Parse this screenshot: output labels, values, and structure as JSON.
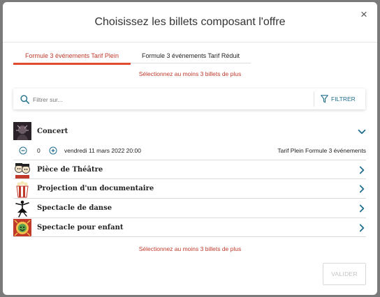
{
  "modal": {
    "title": "Choisissez les billets composant l'offre",
    "close_icon": "×"
  },
  "tabs": [
    {
      "label": "Formule 3 événements Tarif Plein",
      "active": true
    },
    {
      "label": "Formule 3 événements Tarif Réduit",
      "active": false
    }
  ],
  "warning_text": "Sélectionnez au moins 3 billets de plus",
  "search": {
    "placeholder": "Filtrer sur...",
    "value": "",
    "filter_label": "FILTRER"
  },
  "events": [
    {
      "title": "Concert",
      "expanded": true,
      "session": {
        "quantity": "0",
        "date": "vendredi 11 mars 2022 20:00",
        "rate": "Tarif Plein Formule 3 événements"
      }
    },
    {
      "title": "Pièce de Théâtre",
      "expanded": false
    },
    {
      "title": "Projection d'un documentaire",
      "expanded": false
    },
    {
      "title": "Spectacle de danse",
      "expanded": false
    },
    {
      "title": "Spectacle pour enfant",
      "expanded": false
    }
  ],
  "footer": {
    "validate_label": "VALIDER",
    "validate_enabled": false
  },
  "colors": {
    "accent": "#e04a2f",
    "link": "#1f6e8c",
    "warning": "#c0392b"
  }
}
